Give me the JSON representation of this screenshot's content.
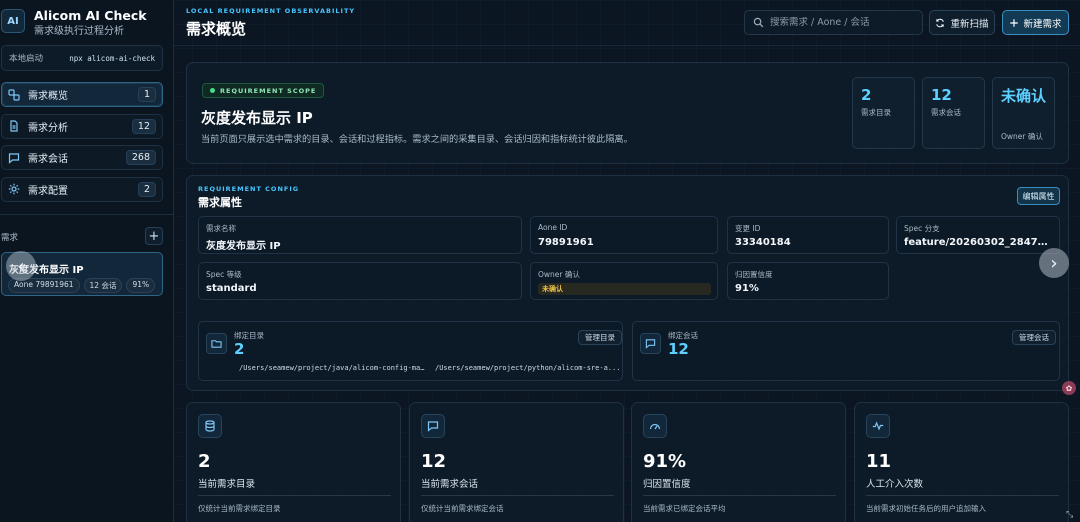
{
  "brand": {
    "logo": "AI",
    "name": "Alicom AI Check",
    "subtitle": "需求级执行过程分析"
  },
  "launch": {
    "label": "本地启动",
    "command": "npx alicom-ai-check"
  },
  "nav": [
    {
      "label": "需求概览",
      "count": "1",
      "icon": "link-icon"
    },
    {
      "label": "需求分析",
      "count": "12",
      "icon": "document-icon"
    },
    {
      "label": "需求会话",
      "count": "268",
      "icon": "chat-icon"
    },
    {
      "label": "需求配置",
      "count": "2",
      "icon": "gear-icon"
    }
  ],
  "requirements": {
    "section_label": "需求",
    "add_label": "+",
    "items": [
      {
        "title": "灰度发布显示 IP",
        "tags": [
          "Aone 79891961",
          "12 会话",
          "91%"
        ]
      }
    ]
  },
  "header": {
    "eyebrow": "LOCAL REQUIREMENT OBSERVABILITY",
    "title": "需求概览",
    "search_placeholder": "搜索需求 / Aone / 会话",
    "rescan_label": "重新扫描",
    "new_label": "新建需求"
  },
  "scope": {
    "badge": "REQUIREMENT SCOPE",
    "title": "灰度发布显示 IP",
    "description": "当前页面只展示选中需求的目录、会话和过程指标。需求之间的采集目录、会话归因和指标统计彼此隔离。",
    "stats": [
      {
        "value": "2",
        "label": "需求目录"
      },
      {
        "value": "12",
        "label": "需求会话"
      },
      {
        "value": "未确认",
        "label": "Owner 确认"
      }
    ]
  },
  "config": {
    "eyebrow": "REQUIREMENT CONFIG",
    "title": "需求属性",
    "edit_label": "编辑属性",
    "fields": [
      {
        "label": "需求名称",
        "value": "灰度发布显示 IP"
      },
      {
        "label": "Aone ID",
        "value": "79891961"
      },
      {
        "label": "变更 ID",
        "value": "33340184"
      },
      {
        "label": "Spec 分支",
        "value": "feature/20260302_28470007_..."
      },
      {
        "label": "Spec 等级",
        "value": "standard"
      },
      {
        "label": "Owner 确认",
        "value": "未确认"
      },
      {
        "label": "归因置信度",
        "value": "91%"
      }
    ],
    "bindings": [
      {
        "label": "绑定目录",
        "count": "2",
        "manage": "管理目录",
        "paths": [
          "/Users/seamew/project/java/alicom-config-ma...",
          "/Users/seamew/project/python/alicom-sre-a..."
        ]
      },
      {
        "label": "绑定会话",
        "count": "12",
        "manage": "管理会话",
        "paths": []
      }
    ]
  },
  "metrics": [
    {
      "icon": "database-icon",
      "value": "2",
      "label": "当前需求目录",
      "desc": "仅统计当前需求绑定目录"
    },
    {
      "icon": "chat-icon",
      "value": "12",
      "label": "当前需求会话",
      "desc": "仅统计当前需求绑定会话"
    },
    {
      "icon": "gauge-icon",
      "value": "91%",
      "label": "归因置信度",
      "desc": "当前需求已绑定会话平均"
    },
    {
      "icon": "pulse-icon",
      "value": "11",
      "label": "人工介入次数",
      "desc": "当前需求初始任务后的用户追加输入"
    }
  ],
  "colors": {
    "accent": "#5cd0ff",
    "background": "#0b1622",
    "warning": "#f0c346",
    "success": "#46e08a"
  }
}
